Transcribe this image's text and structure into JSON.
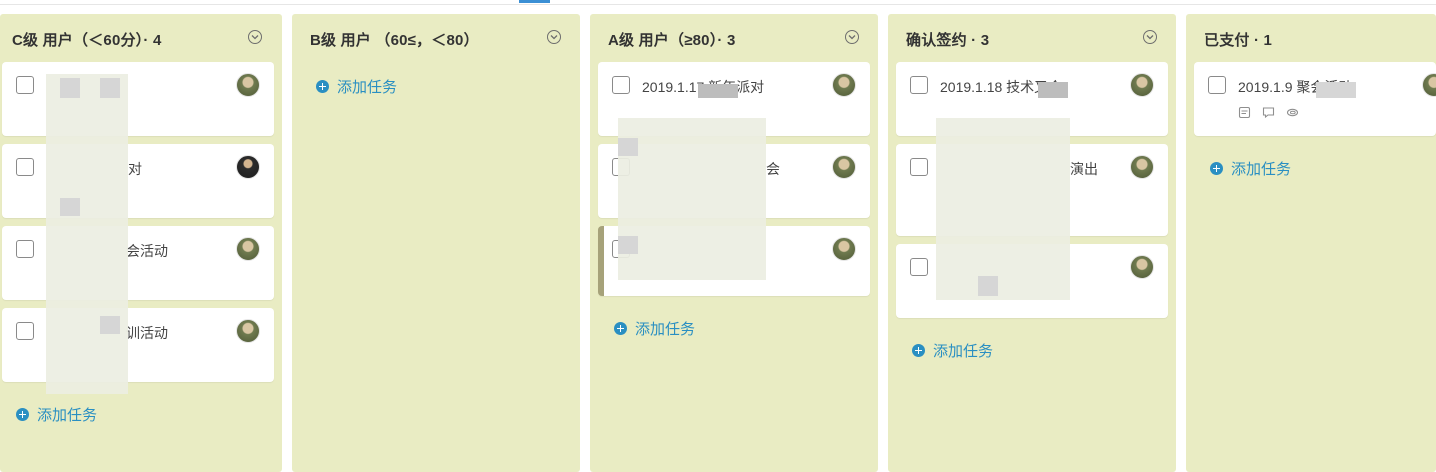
{
  "board": {
    "columns": [
      {
        "title": "C级 用户（＜60分）· 4",
        "add_task_label": "添加任务",
        "cards": [
          {
            "title": "",
            "avatar": "avatar-icon"
          },
          {
            "title": "对",
            "avatar": "avatar-icon"
          },
          {
            "title": "会活动",
            "avatar": "avatar-icon"
          },
          {
            "title": "训活动",
            "avatar": "avatar-icon"
          }
        ]
      },
      {
        "title": "B级 用户 （60≤，＜80）",
        "add_task_label": "添加任务",
        "cards": []
      },
      {
        "title": "A级 用户（≥80）· 3",
        "add_task_label": "添加任务",
        "cards": [
          {
            "title": "2019.1.17 新年派对",
            "avatar": "avatar-icon"
          },
          {
            "title": "会",
            "avatar": "avatar-icon"
          },
          {
            "title": "",
            "avatar": "avatar-icon"
          }
        ]
      },
      {
        "title": "确认签约 · 3",
        "add_task_label": "添加任务",
        "cards": [
          {
            "title": "2019.1.18 技术叉会",
            "avatar": "avatar-icon"
          },
          {
            "title": "演出",
            "avatar": "avatar-icon"
          },
          {
            "title": "",
            "avatar": "avatar-icon"
          }
        ]
      },
      {
        "title": "已支付 · 1",
        "add_task_label": "添加任务",
        "cards": [
          {
            "title": "2019.1.9 聚会活动",
            "avatar": "avatar-icon",
            "meta_icons": [
              "note-icon",
              "comment-icon",
              "attachment-icon"
            ]
          }
        ]
      }
    ]
  },
  "colors": {
    "column_bg": "#e9ecc3",
    "link": "#2a8fc2",
    "tab_indicator": "#3b8fd4"
  }
}
